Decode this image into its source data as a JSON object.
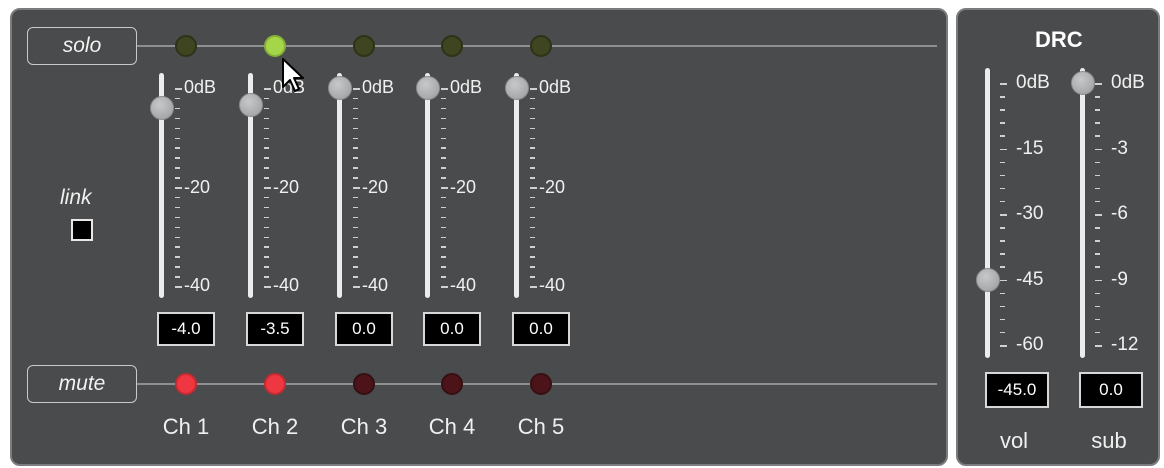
{
  "mixer": {
    "solo_label": "solo",
    "mute_label": "mute",
    "link_label": "link",
    "link_checked": false,
    "channels": [
      {
        "name": "Ch 1",
        "value": "-4.0",
        "solo": false,
        "mute": true
      },
      {
        "name": "Ch 2",
        "value": "-3.5",
        "solo": true,
        "mute": true
      },
      {
        "name": "Ch 3",
        "value": "0.0",
        "solo": false,
        "mute": false
      },
      {
        "name": "Ch 4",
        "value": "0.0",
        "solo": false,
        "mute": false
      },
      {
        "name": "Ch 5",
        "value": "0.0",
        "solo": false,
        "mute": false
      }
    ],
    "scale_labels": [
      "0dB",
      "-20",
      "-40"
    ],
    "scale_min": -40,
    "scale_max": 0
  },
  "drc": {
    "title": "DRC",
    "vol": {
      "label": "vol",
      "value": "-45.0",
      "scale_labels": [
        "0dB",
        "-15",
        "-30",
        "-45",
        "-60"
      ],
      "min": -60,
      "max": 0
    },
    "sub": {
      "label": "sub",
      "value": "0.0",
      "scale_labels": [
        "0dB",
        "-3",
        "-6",
        "-9",
        "-12"
      ],
      "min": -12,
      "max": 0
    }
  },
  "colors": {
    "panel_bg": "#4a4b4c",
    "solo_on": "#a5d64a",
    "solo_off": "#3e4520",
    "mute_on": "#ee3740",
    "mute_off": "#4c1418"
  }
}
